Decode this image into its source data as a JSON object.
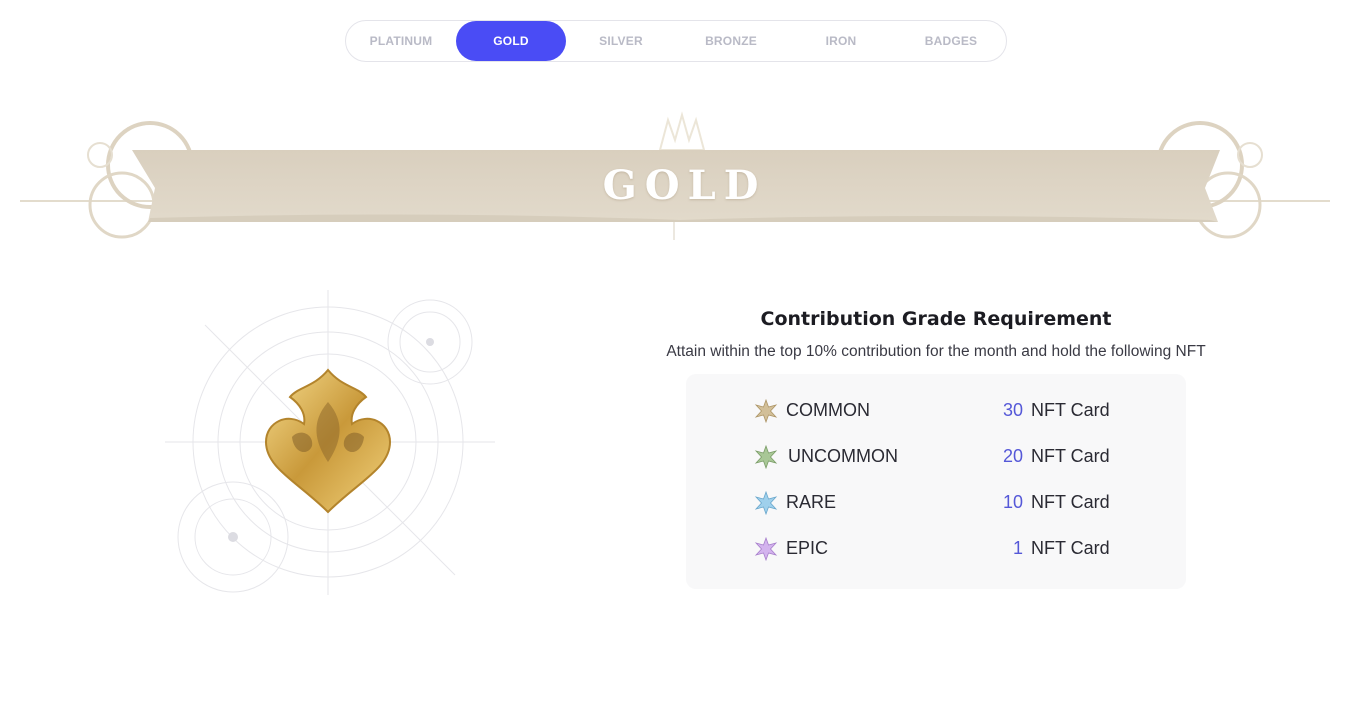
{
  "tabs": [
    {
      "label": "PLATINUM",
      "active": false
    },
    {
      "label": "GOLD",
      "active": true
    },
    {
      "label": "SILVER",
      "active": false
    },
    {
      "label": "BRONZE",
      "active": false
    },
    {
      "label": "IRON",
      "active": false
    },
    {
      "label": "BADGES",
      "active": false
    }
  ],
  "banner": {
    "title": "GOLD",
    "icon": "ribbon-banner"
  },
  "emblem": {
    "icon": "gold-emblem-icon"
  },
  "requirement": {
    "title": "Contribution Grade Requirement",
    "subtitle": "Attain within the top 10% contribution for the month and hold the following NFT",
    "items": [
      {
        "grade": "COMMON",
        "count": "30",
        "unit": "NFT Card",
        "gem_color": "#c9b48a"
      },
      {
        "grade": "UNCOMMON",
        "count": "20",
        "unit": "NFT Card",
        "gem_color": "#9fbf8e"
      },
      {
        "grade": "RARE",
        "count": "10",
        "unit": "NFT Card",
        "gem_color": "#8fc7e6"
      },
      {
        "grade": "EPIC",
        "count": "1",
        "unit": "NFT Card",
        "gem_color": "#c9a6e6"
      }
    ]
  },
  "colors": {
    "accent": "#4a4cf5",
    "count": "#5558d8",
    "banner": "#dcd2c2"
  }
}
